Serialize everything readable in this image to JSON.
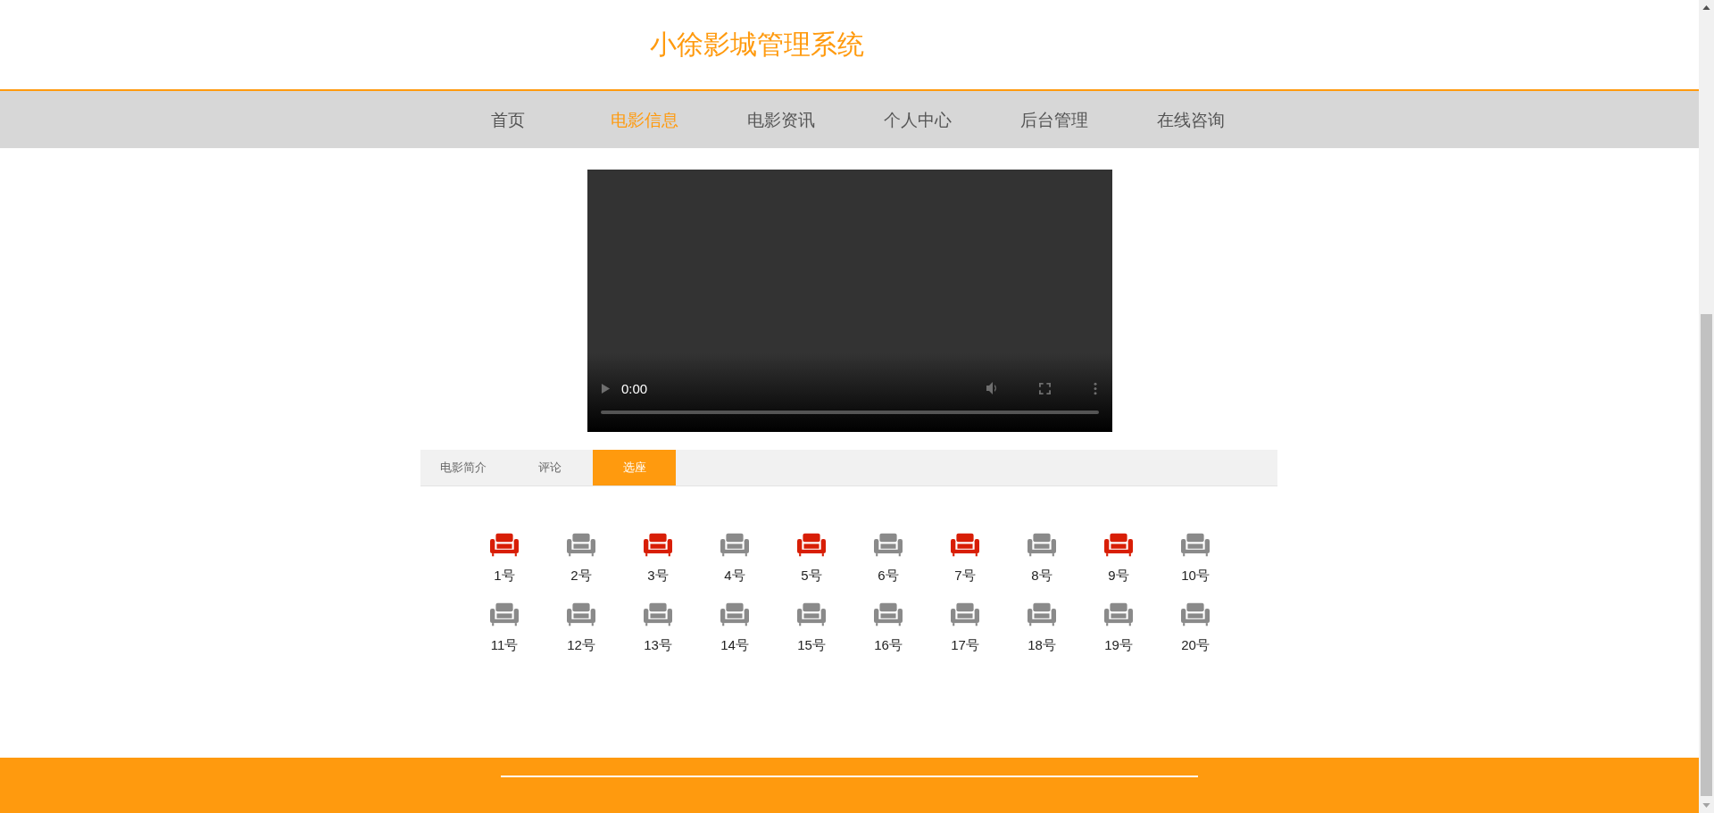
{
  "header": {
    "title": "小徐影城管理系统"
  },
  "nav": [
    {
      "label": "首页",
      "selected": false
    },
    {
      "label": "电影信息",
      "selected": true
    },
    {
      "label": "电影资讯",
      "selected": false
    },
    {
      "label": "个人中心",
      "selected": false
    },
    {
      "label": "后台管理",
      "selected": false
    },
    {
      "label": "在线咨询",
      "selected": false
    }
  ],
  "video": {
    "time": "0:00",
    "level": 0
  },
  "tabs": [
    {
      "label": "电影简介",
      "selected": false
    },
    {
      "label": "评论",
      "selected": false
    },
    {
      "label": "选座",
      "selected": true
    }
  ],
  "seats": [
    {
      "label": "1号",
      "taken": true
    },
    {
      "label": "2号",
      "taken": false
    },
    {
      "label": "3号",
      "taken": true
    },
    {
      "label": "4号",
      "taken": false
    },
    {
      "label": "5号",
      "taken": true
    },
    {
      "label": "6号",
      "taken": false
    },
    {
      "label": "7号",
      "taken": true
    },
    {
      "label": "8号",
      "taken": false
    },
    {
      "label": "9号",
      "taken": true
    },
    {
      "label": "10号",
      "taken": false
    },
    {
      "label": "11号",
      "taken": false
    },
    {
      "label": "12号",
      "taken": false
    },
    {
      "label": "13号",
      "taken": false
    },
    {
      "label": "14号",
      "taken": false
    },
    {
      "label": "15号",
      "taken": false
    },
    {
      "label": "16号",
      "taken": false
    },
    {
      "label": "17号",
      "taken": false
    },
    {
      "label": "18号",
      "taken": false
    },
    {
      "label": "19号",
      "taken": false
    },
    {
      "label": "20号",
      "taken": false
    }
  ]
}
